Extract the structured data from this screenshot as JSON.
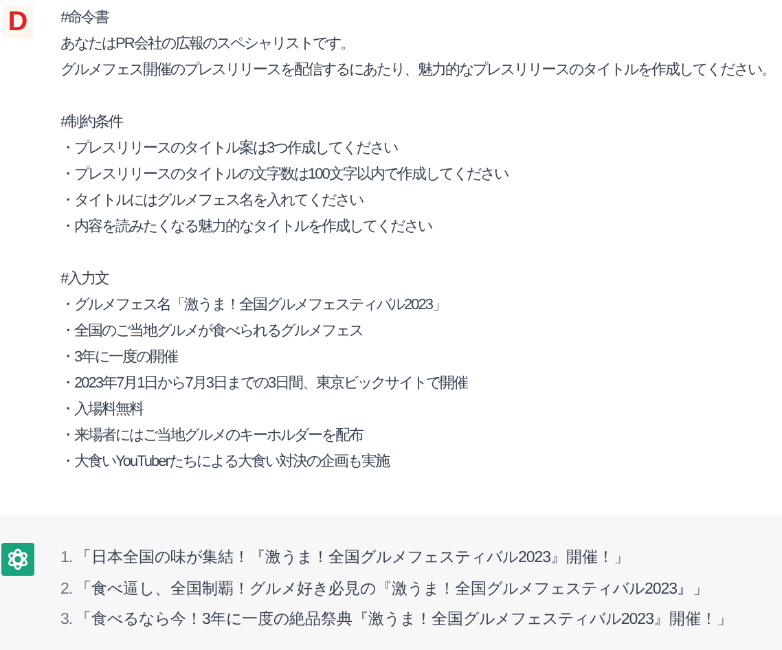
{
  "user_message": {
    "avatar_letter": "D",
    "paragraphs": [
      [
        "#命令書",
        "あなたはPR会社の広報のスペシャリストです。",
        "グルメフェス開催のプレスリリースを配信するにあたり、魅力的なプレスリリースのタイトルを作成してください。"
      ],
      [
        "#制約条件",
        "・プレスリリースのタイトル案は3つ作成してください",
        "・プレスリリースのタイトルの文字数は100文字以内で作成してください",
        "・タイトルにはグルメフェス名を入れてください",
        "・内容を読みたくなる魅力的なタイトルを作成してください"
      ],
      [
        "#入力文",
        "・グルメフェス名「激うま！全国グルメフェスティバル2023」",
        "・全国のご当地グルメが食べられるグルメフェス",
        "・3年に一度の開催",
        "・2023年7月1日から7月3日までの3日間、東京ビックサイトで開催",
        "・入場料無料",
        "・来場者にはご当地グルメのキーホルダーを配布",
        "・大食いYouTuberたちによる大食い対決の企画も実施"
      ]
    ]
  },
  "assistant_message": {
    "items": [
      {
        "number": "1.",
        "text": "「日本全国の味が集結！『激うま！全国グルメフェスティバル2023』開催！」"
      },
      {
        "number": "2.",
        "text": "「食べ逼し、全国制覇！グルメ好き必見の『激うま！全国グルメフェスティバル2023』」"
      },
      {
        "number": "3.",
        "text": "「食べるなら今！3年に一度の絶品祭典『激うま！全国グルメフェスティバル2023』開催！」"
      }
    ]
  }
}
